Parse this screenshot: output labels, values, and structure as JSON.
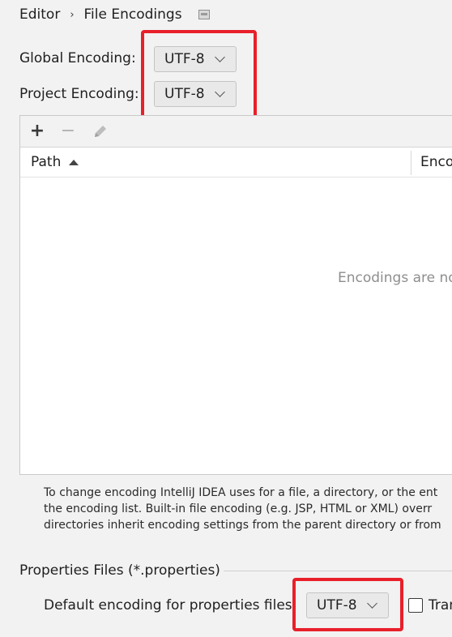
{
  "breadcrumb": {
    "parent": "Editor",
    "separator": "›",
    "current": "File Encodings"
  },
  "global_encoding": {
    "label": "Global Encoding:",
    "value": "UTF-8"
  },
  "project_encoding": {
    "label": "Project Encoding:",
    "value": "UTF-8"
  },
  "toolbar": {
    "add": "+",
    "remove": "−",
    "edit_icon": "pencil-icon"
  },
  "table": {
    "columns": [
      "Path",
      "Enco"
    ],
    "sort_column": "Path",
    "sort_direction": "ascending",
    "empty_text": "Encodings are no"
  },
  "description": {
    "lines": [
      "To change encoding IntelliJ IDEA uses for a file, a directory, or the ent",
      "the encoding list. Built-in file encoding (e.g. JSP, HTML or XML) overr",
      "directories inherit encoding settings from the parent directory or from"
    ]
  },
  "properties_section": {
    "title": "Properties Files (*.properties)",
    "default_label": "Default encoding for properties files:",
    "default_value": "UTF-8",
    "checkbox_label": "Tran",
    "checkbox_checked": false
  },
  "colors": {
    "highlight": "#e8202a",
    "background": "#f2f2f2",
    "table_background": "#ffffff",
    "muted_text": "#8e8e8e"
  }
}
